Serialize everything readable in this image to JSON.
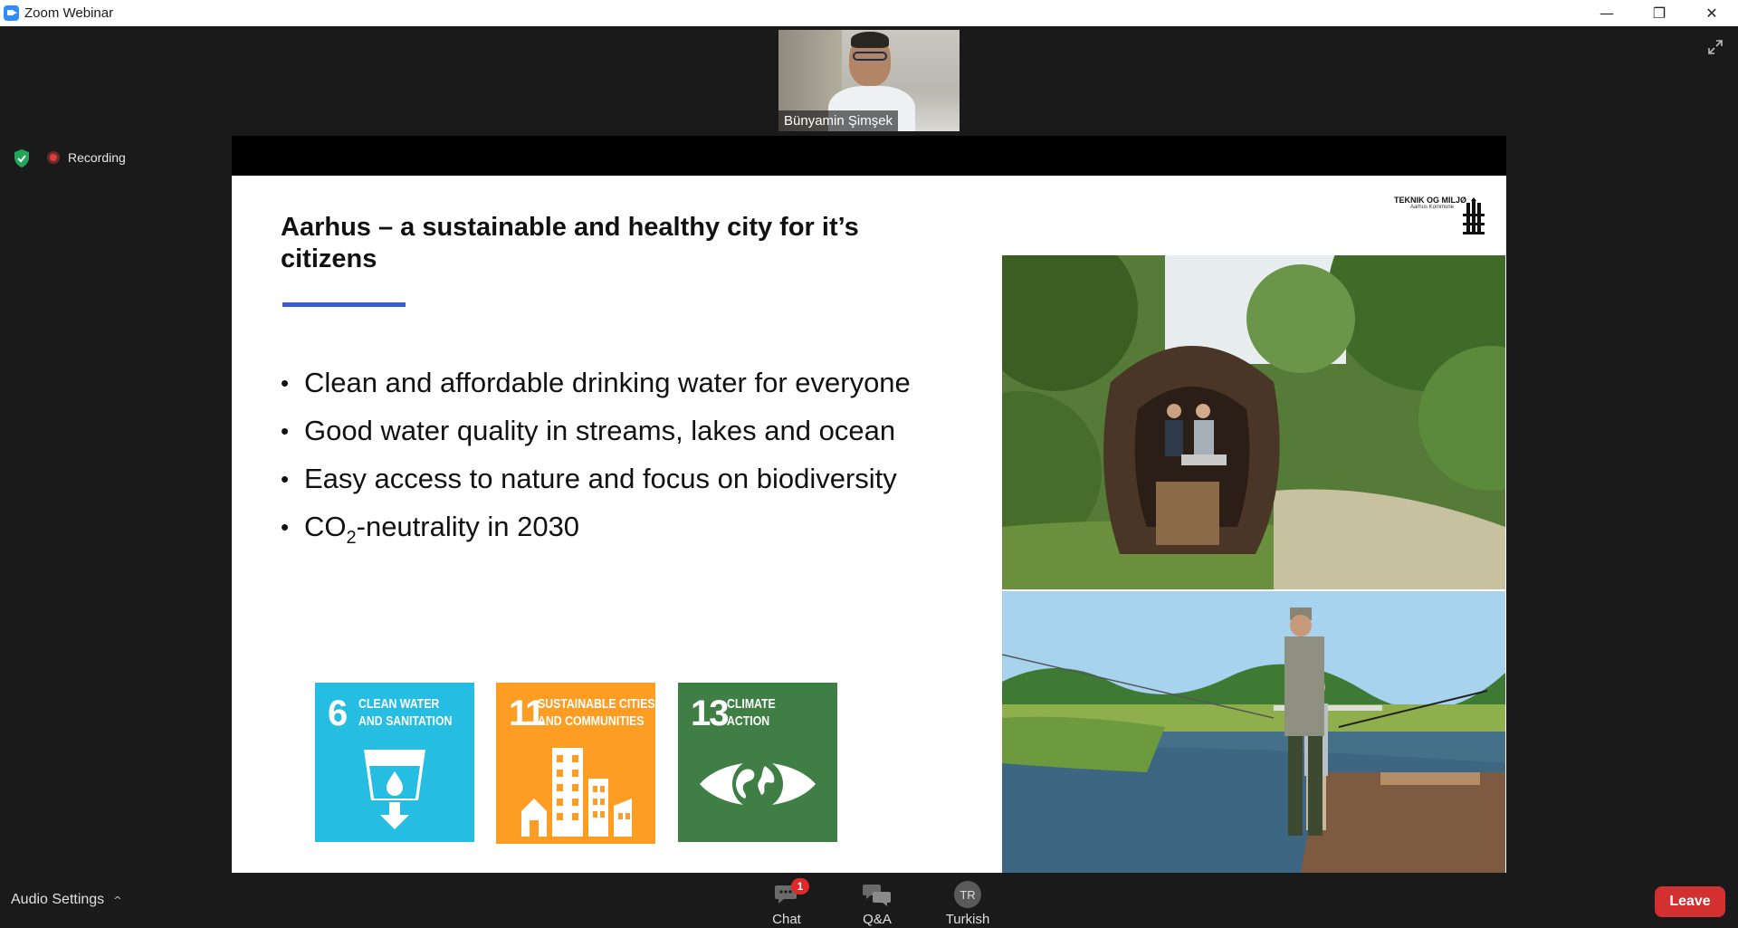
{
  "window": {
    "title": "Zoom Webinar",
    "minimize_glyph": "—",
    "restore_glyph": "❐",
    "close_glyph": "✕"
  },
  "speaker": {
    "name": "Bünyamin Şimşek"
  },
  "status": {
    "recording_label": "Recording",
    "security_color": "#23a55a"
  },
  "slide": {
    "title": "Aarhus – a sustainable and healthy city for it’s citizens",
    "accent_color": "#3a5bd6",
    "bullets": [
      "Clean and affordable drinking water for everyone",
      "Good water quality in streams, lakes and ocean",
      "Easy access to nature and focus on biodiversity"
    ],
    "co2_bullet": {
      "prefix": "CO",
      "subscript": "2",
      "suffix": "-neutrality in 2030"
    },
    "sdgs": [
      {
        "number": "6",
        "line1": "CLEAN WATER",
        "line2": "AND SANITATION",
        "color": "#26bde2"
      },
      {
        "number": "11",
        "line1": "SUSTAINABLE CITIES",
        "line2": "AND COMMUNITIES",
        "color": "#fd9d24"
      },
      {
        "number": "13",
        "line1": "CLIMATE",
        "line2": "ACTION",
        "color": "#3f7e44"
      }
    ],
    "logo": {
      "name": "TEKNIK OG MILJØ",
      "sub": "Aarhus Kommune"
    }
  },
  "toolbar": {
    "audio_settings": "Audio Settings",
    "caret": "^",
    "chat_label": "Chat",
    "chat_badge": "1",
    "qa_label": "Q&A",
    "language_initials": "TR",
    "language_label": "Turkish",
    "leave_label": "Leave",
    "leave_color": "#d33131"
  }
}
